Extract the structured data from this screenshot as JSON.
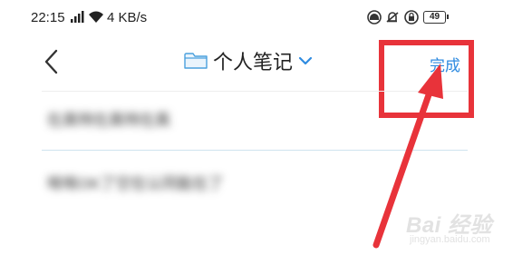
{
  "status_bar": {
    "time": "22:15",
    "network_speed": "4 KB/s",
    "battery": "49",
    "icons": [
      "signal-icon",
      "wifi-icon",
      "headset-icon",
      "alarm-off-icon",
      "rotation-lock-icon",
      "battery-icon"
    ]
  },
  "nav": {
    "back_icon": "chevron-left-icon",
    "folder_icon": "folder-icon",
    "title": "个人笔记",
    "dropdown_icon": "chevron-down-icon",
    "done_label": "完成"
  },
  "notes": [
    {
      "text": "在真特在真特在真"
    },
    {
      "text": "唉唉OK了空在认同能在了"
    }
  ],
  "watermark": {
    "main": "Bai 经验",
    "sub": "jingyan.baidu.com"
  },
  "colors": {
    "accent": "#2f8be0",
    "annotation_red": "#e8333a"
  }
}
